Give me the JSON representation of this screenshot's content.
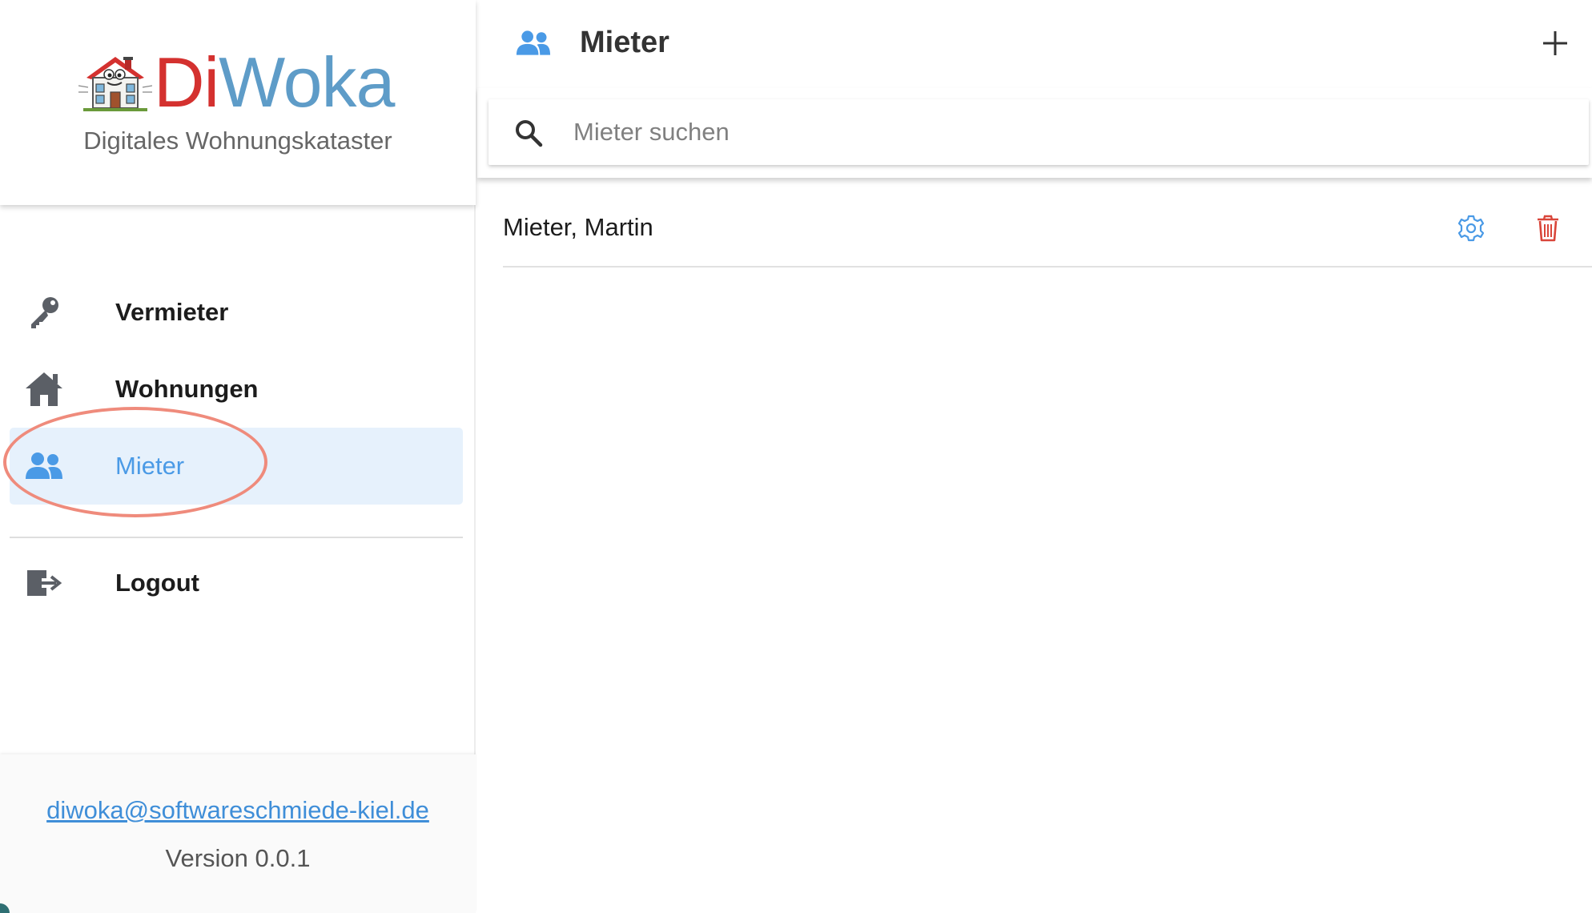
{
  "brand": {
    "name_part1": "Di",
    "name_part2": "Woka",
    "subtitle": "Digitales Wohnungskataster",
    "logo_icon": "house-mascot-logo",
    "colors": {
      "di": "#d4312f",
      "woka": "#5e9cc8"
    }
  },
  "sidebar": {
    "items": [
      {
        "label": "Vermieter",
        "icon": "key-icon",
        "active": false
      },
      {
        "label": "Wohnungen",
        "icon": "home-icon",
        "active": false
      },
      {
        "label": "Mieter",
        "icon": "people-icon",
        "active": true
      }
    ],
    "logout": {
      "label": "Logout",
      "icon": "logout-icon"
    },
    "active_color": "#4a9ae6",
    "active_bg": "#e6f1fc"
  },
  "footer": {
    "email": "diwoka@softwareschmiede-kiel.de",
    "version": "Version 0.0.1"
  },
  "main": {
    "title": "Mieter",
    "title_icon": "people-icon",
    "add_icon": "plus-icon",
    "search": {
      "placeholder": "Mieter suchen",
      "value": "",
      "icon": "search-icon"
    },
    "tenants": [
      {
        "name": "Mieter, Martin",
        "settings_icon": "gear-icon",
        "delete_icon": "trash-icon"
      }
    ],
    "accent_color": "#4a9ae6",
    "delete_color": "#d9463a"
  }
}
